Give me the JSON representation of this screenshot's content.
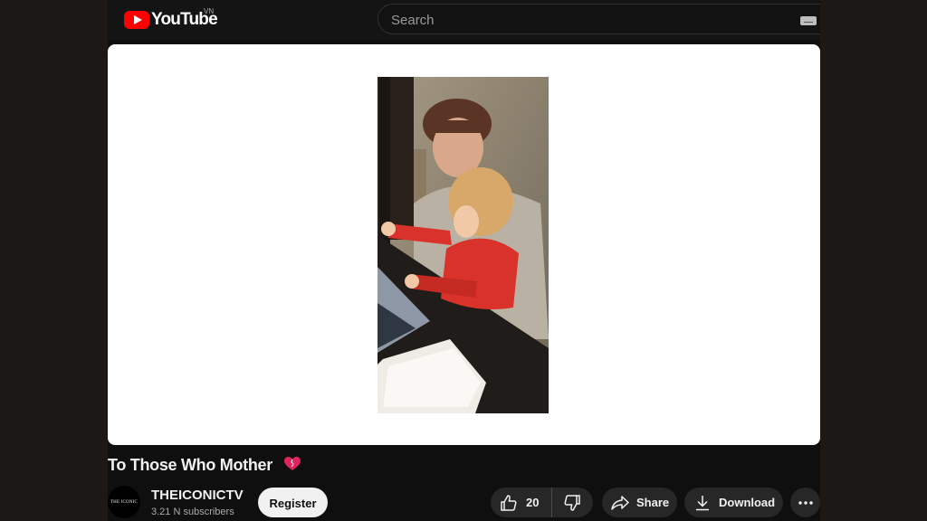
{
  "header": {
    "logo_text": "YouTube",
    "region_code": "VN",
    "search_placeholder": "Search"
  },
  "video": {
    "title": "To Those Who Mother",
    "thumbnail_icons": [
      "heart-icon"
    ]
  },
  "channel": {
    "name": "THEICONICTV",
    "avatar_text": "THE ICONIC",
    "subscribers": "3.21 N subscribers",
    "register_label": "Register"
  },
  "actions": {
    "like_count": "20",
    "share_label": "Share",
    "download_label": "Download"
  },
  "colors": {
    "brand_red": "#ff0000",
    "page_bg": "#0f0f0f",
    "pill_bg": "#272727",
    "register_bg": "#f1f1f1",
    "heart": "#e0245e"
  }
}
